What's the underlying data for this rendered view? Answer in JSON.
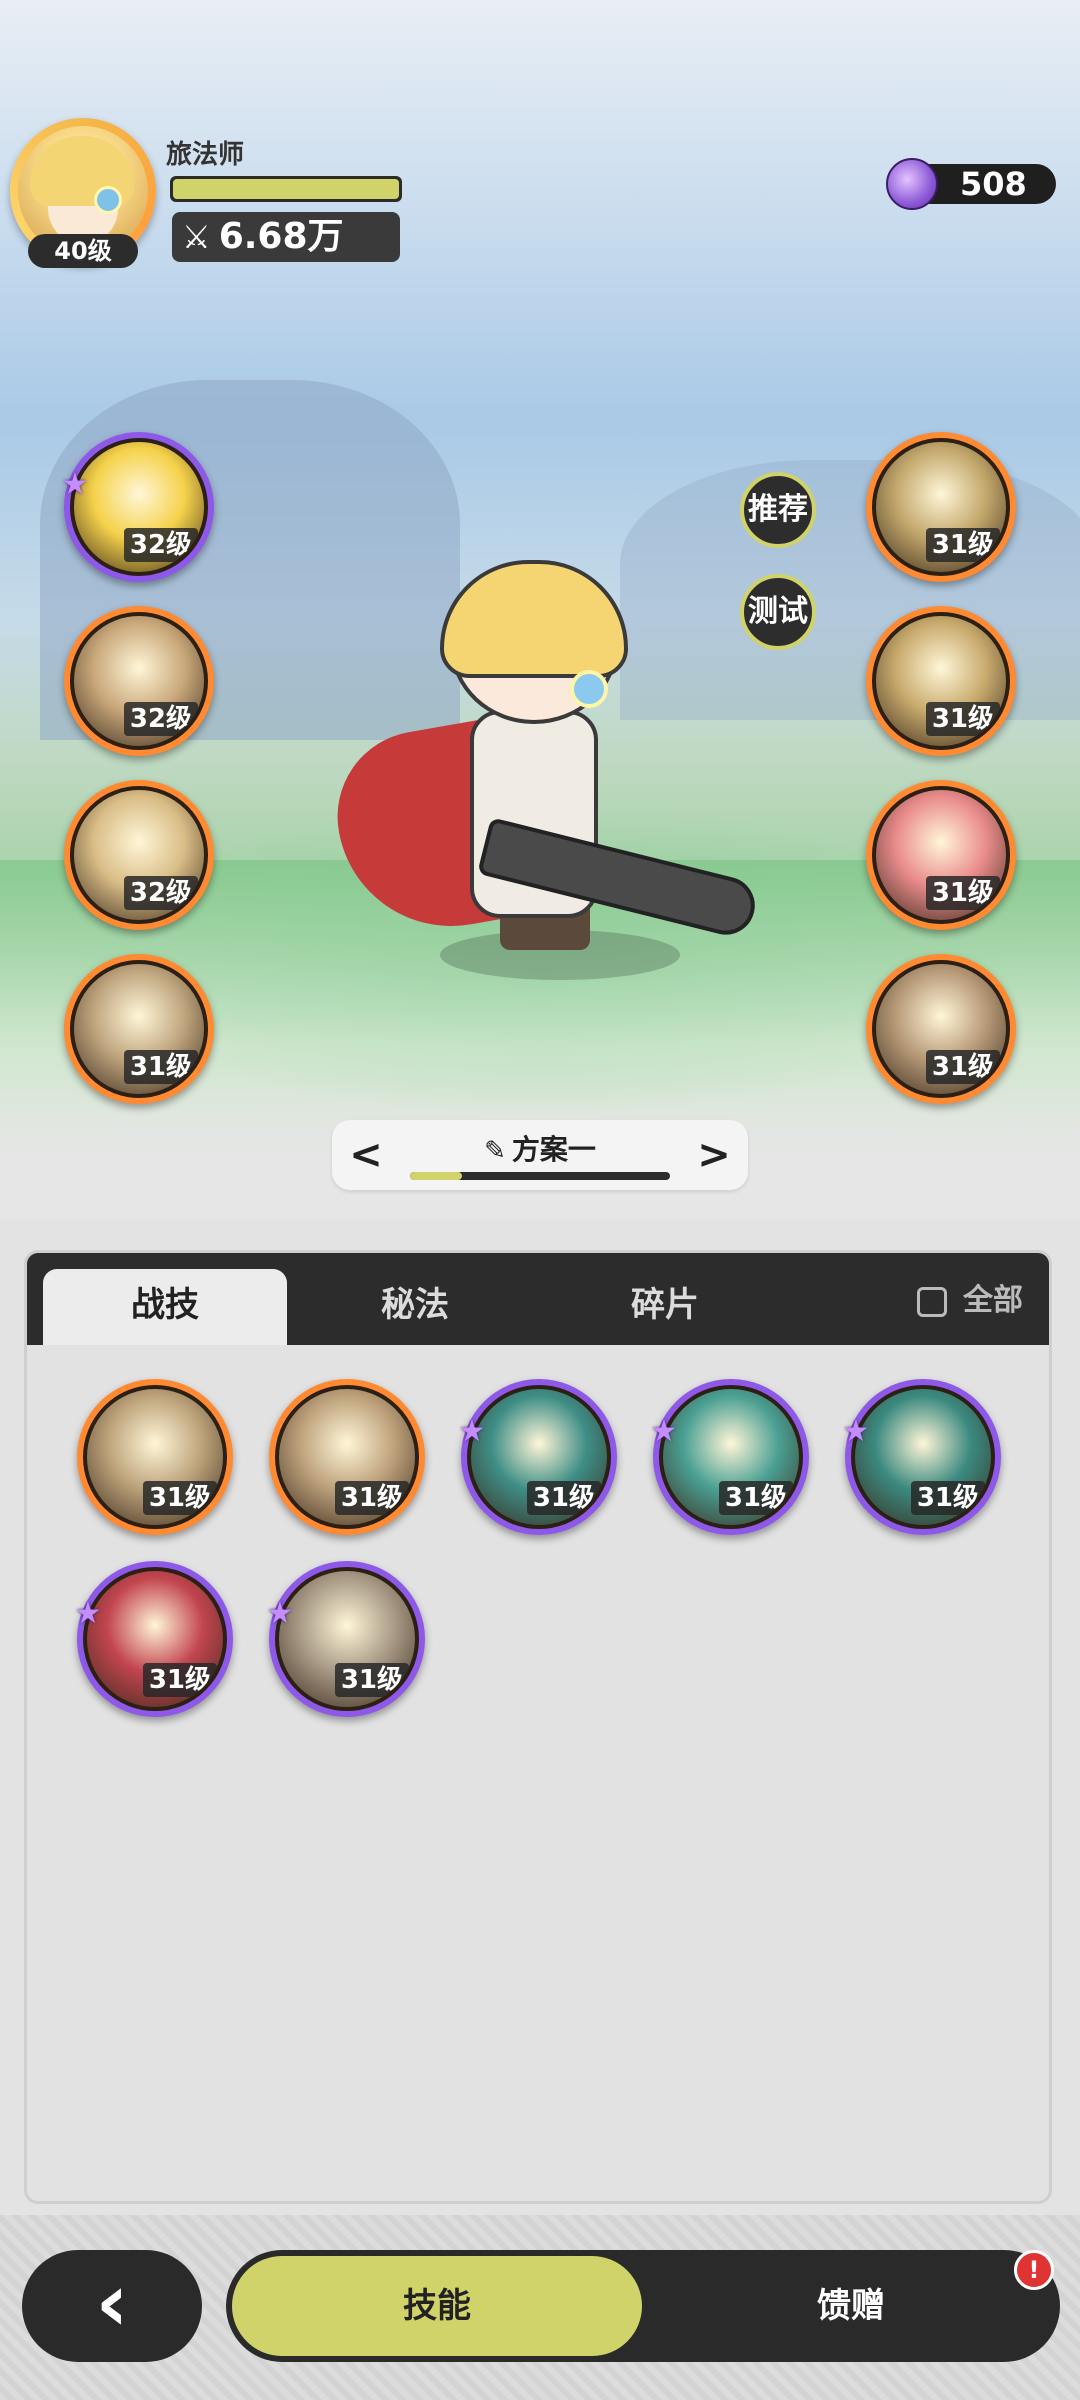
{
  "player": {
    "name": "旅法师",
    "level": "40级",
    "power": "6.68万",
    "hp_fraction": 1.0
  },
  "currency": {
    "value": "508",
    "icon": "purple-crystal-icon"
  },
  "side_buttons": {
    "recommend": "推荐",
    "test": "测试"
  },
  "left_skills": [
    {
      "level": "32级",
      "rarity": "purple",
      "starred": true,
      "icon": "golden-burst-icon",
      "color": "#f5d24a"
    },
    {
      "level": "32级",
      "rarity": "orange",
      "starred": false,
      "icon": "claw-slash-icon",
      "color": "#c9a87a"
    },
    {
      "level": "32级",
      "rarity": "orange",
      "starred": false,
      "icon": "explosion-icon",
      "color": "#d9bd86"
    },
    {
      "level": "31级",
      "rarity": "orange",
      "starred": false,
      "icon": "sword-strike-icon",
      "color": "#bfa57e"
    }
  ],
  "right_skills": [
    {
      "level": "31级",
      "rarity": "orange",
      "starred": false,
      "icon": "golem-icon",
      "color": "#c2a76b"
    },
    {
      "level": "31级",
      "rarity": "orange",
      "starred": false,
      "icon": "eye-icon",
      "color": "#c8aa6d"
    },
    {
      "level": "31级",
      "rarity": "orange",
      "starred": false,
      "icon": "red-sword-icon",
      "color": "#e98b8b"
    },
    {
      "level": "31级",
      "rarity": "orange",
      "starred": false,
      "icon": "fist-icon",
      "color": "#b79a78"
    }
  ],
  "plan": {
    "label": "方案一",
    "progress": 0.2
  },
  "tabs": {
    "t1": "战技",
    "t2": "秘法",
    "t3": "碎片",
    "all": "全部",
    "active": "战技"
  },
  "grid_skills": [
    {
      "level": "31级",
      "rarity": "orange",
      "starred": false,
      "icon": "crescent-slash-icon",
      "color": "#bca27a"
    },
    {
      "level": "31级",
      "rarity": "orange",
      "starred": false,
      "icon": "leap-strike-icon",
      "color": "#bda17b"
    },
    {
      "level": "31级",
      "rarity": "purple",
      "starred": true,
      "icon": "teal-crescent-icon",
      "color": "#3e8e86"
    },
    {
      "level": "31级",
      "rarity": "purple",
      "starred": true,
      "icon": "teal-web-icon",
      "color": "#4aa093"
    },
    {
      "level": "31级",
      "rarity": "purple",
      "starred": true,
      "icon": "teal-sword-icon",
      "color": "#3b8a80"
    },
    {
      "level": "31级",
      "rarity": "purple",
      "starred": true,
      "icon": "red-warrior-icon",
      "color": "#c2454f"
    },
    {
      "level": "31级",
      "rarity": "purple",
      "starred": true,
      "icon": "shadow-clone-icon",
      "color": "#a89a86"
    }
  ],
  "bottom": {
    "active": "技能",
    "other": "馈赠",
    "alert": "!"
  }
}
